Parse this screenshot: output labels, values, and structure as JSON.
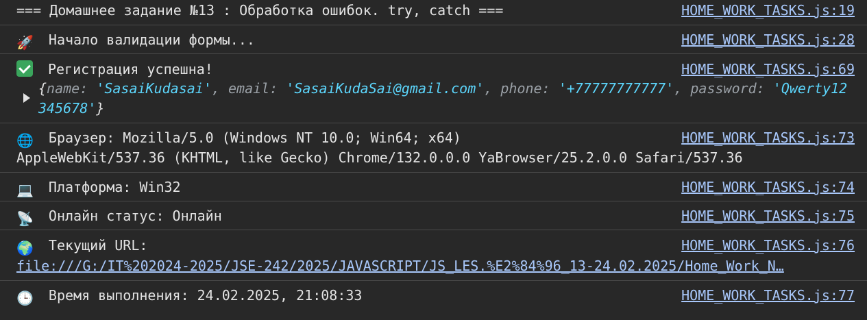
{
  "entries": [
    {
      "icon": "",
      "text": "=== Домашнее задание №13 : Обработка ошибок. try, catch ===",
      "source": "HOME_WORK_TASKS.js:19"
    },
    {
      "icon": "🚀",
      "text": "Начало валидации формы...",
      "source": "HOME_WORK_TASKS.js:28"
    },
    {
      "icon": "✅",
      "text": "Регистрация успешна!",
      "source": "HOME_WORK_TASKS.js:69"
    },
    {
      "icon": "🌐",
      "text": "Браузер: Mozilla/5.0 (Windows NT 10.0; Win64; x64)",
      "continuation": "AppleWebKit/537.36 (KHTML, like Gecko) Chrome/132.0.0.0 YaBrowser/25.2.0.0 Safari/537.36",
      "source": "HOME_WORK_TASKS.js:73"
    },
    {
      "icon": "💻",
      "text": "Платформа: Win32",
      "source": "HOME_WORK_TASKS.js:74"
    },
    {
      "icon": "📡",
      "text": "Онлайн статус: Онлайн",
      "source": "HOME_WORK_TASKS.js:75"
    },
    {
      "icon": "🌍",
      "text": "Текущий URL:",
      "url": "file:///G:/IT%202024-2025/JSE-242/2025/JAVASCRIPT/JS_LES.%E2%84%96_13-24.02.2025/Home_Work_N…",
      "source": "HOME_WORK_TASKS.js:76"
    },
    {
      "icon": "🕒",
      "text": "Время выполнения: 24.02.2025, 21:08:33",
      "source": "HOME_WORK_TASKS.js:77"
    }
  ],
  "registration_object": {
    "open": "{",
    "close": "}",
    "fields": [
      {
        "key": "name",
        "value": "'SasaiKudasai'"
      },
      {
        "key": "email",
        "value": "'SasaiKudaSai@gmail.com'"
      },
      {
        "key": "phone",
        "value": "'+77777777777'"
      },
      {
        "key": "password",
        "value": "'Qwerty12345678'"
      }
    ]
  },
  "colors": {
    "background": "#282828",
    "text": "#e3e3e3",
    "link": "#a8c7fa",
    "string": "#5cd5fb",
    "key": "#9aa0a6",
    "divider": "#4a4a4a"
  }
}
